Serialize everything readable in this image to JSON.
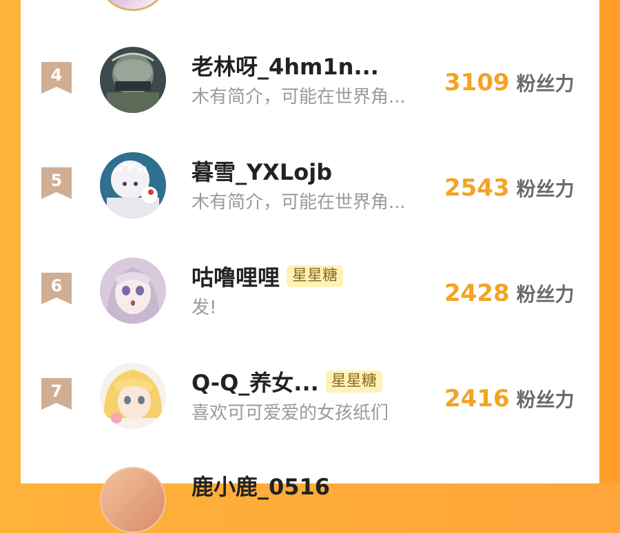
{
  "leaderboard": {
    "unit": "粉丝力",
    "entries": [
      {
        "rank": "4",
        "name": "老林呀_4hm1n...",
        "badge": "",
        "desc": "木有简介，可能在世界角...",
        "score": "3109"
      },
      {
        "rank": "5",
        "name": "暮雪_YXLojb",
        "badge": "",
        "desc": "木有简介，可能在世界角...",
        "score": "2543"
      },
      {
        "rank": "6",
        "name": "咕噜哩哩",
        "badge": "星星糖",
        "desc": "发!",
        "score": "2428"
      },
      {
        "rank": "7",
        "name": "Q-Q_养女...",
        "badge": "星星糖",
        "desc": "喜欢可可爱爱的女孩纸们",
        "score": "2416"
      }
    ],
    "next_partial_name": "鹿小鹿_0516"
  },
  "icons": {
    "rank_ribbon": "ribbon-bookmark-icon",
    "avatar": "avatar-image"
  },
  "colors": {
    "accent": "#f4a322",
    "rank_ribbon": "#cfae94",
    "badge_bg": "#fff2b8"
  }
}
